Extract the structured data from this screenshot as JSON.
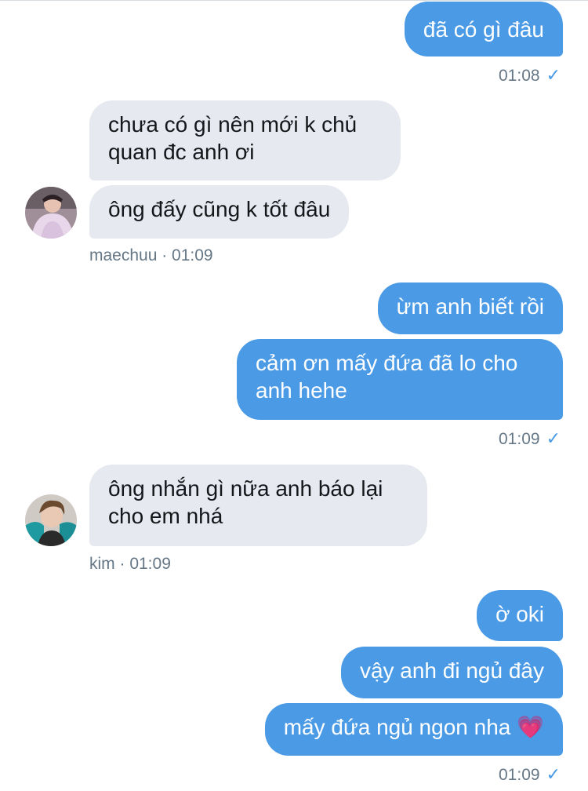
{
  "messages": [
    {
      "text": "đã có gì đâu"
    },
    {
      "text": "chưa có gì nên mới k chủ quan đc anh ơi"
    },
    {
      "text": "ông đấy cũng k tốt đâu"
    },
    {
      "text": "ừm anh biết rồi"
    },
    {
      "text": "cảm ơn mấy đứa đã lo cho anh hehe"
    },
    {
      "text": "ông nhắn gì nữa anh báo lại cho em nhá"
    },
    {
      "text": "ờ oki"
    },
    {
      "text": "vậy anh đi ngủ đây"
    },
    {
      "text": "mấy đứa ngủ ngon nha 💗"
    }
  ],
  "meta": {
    "time1": "01:08",
    "time2": "01:09",
    "sender1": "maechuu · 01:09",
    "time3": "01:09",
    "sender2": "kim · 01:09",
    "time4": "01:09",
    "read_check": "✓"
  },
  "colors": {
    "outgoing_bubble": "#4a9ae6",
    "incoming_bubble": "#e6e9ef",
    "meta_text": "#657786"
  },
  "icons": {
    "read_receipt": "check-icon",
    "avatar1": "user-avatar-maechuu",
    "avatar2": "user-avatar-kim"
  }
}
